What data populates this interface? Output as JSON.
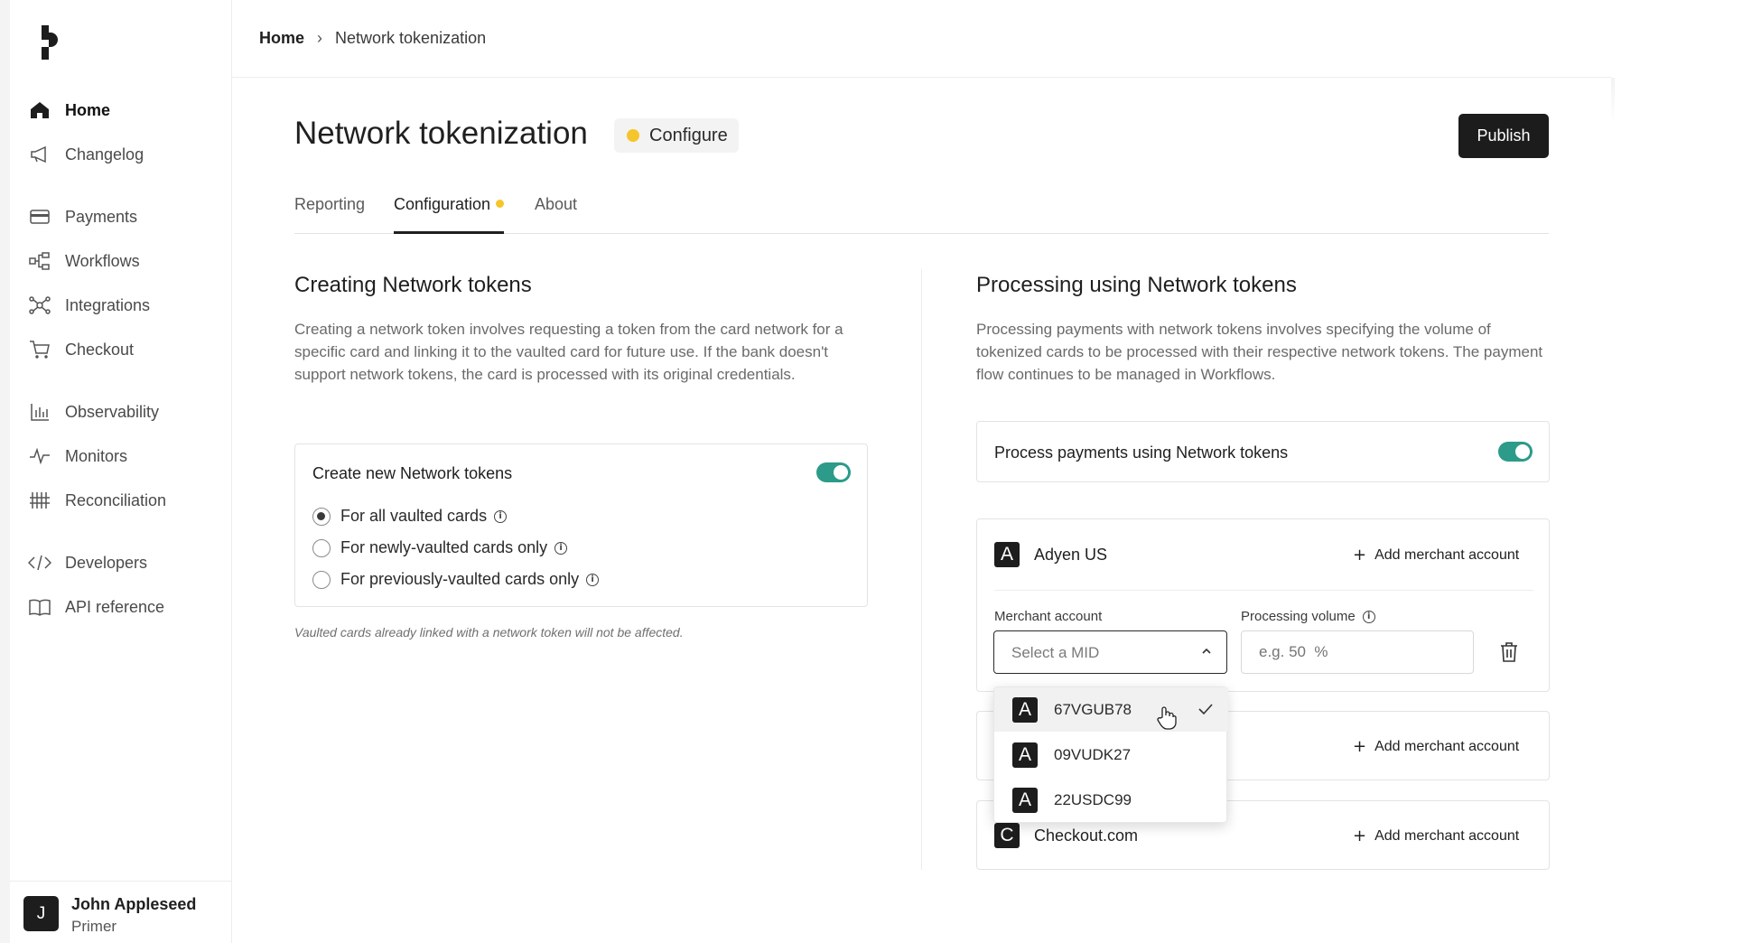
{
  "sidebar": {
    "logo": "primer-logo",
    "items": [
      {
        "label": "Home",
        "icon": "home-icon",
        "active": true
      },
      {
        "label": "Changelog",
        "icon": "megaphone-icon"
      },
      {
        "label": "Payments",
        "icon": "card-icon"
      },
      {
        "label": "Workflows",
        "icon": "workflow-icon"
      },
      {
        "label": "Integrations",
        "icon": "integrations-icon"
      },
      {
        "label": "Checkout",
        "icon": "cart-icon"
      },
      {
        "label": "Observability",
        "icon": "bar-chart-icon"
      },
      {
        "label": "Monitors",
        "icon": "pulse-icon"
      },
      {
        "label": "Reconciliation",
        "icon": "reconciliation-icon"
      },
      {
        "label": "Developers",
        "icon": "code-icon"
      },
      {
        "label": "API reference",
        "icon": "book-icon"
      }
    ],
    "user": {
      "initial": "J",
      "name": "John Appleseed",
      "org": "Primer"
    }
  },
  "breadcrumb": {
    "home": "Home",
    "separator": "›",
    "current": "Network tokenization"
  },
  "header": {
    "title": "Network tokenization",
    "status_badge": "Configure",
    "publish_label": "Publish"
  },
  "tabs": [
    {
      "label": "Reporting"
    },
    {
      "label": "Configuration",
      "active": true,
      "has_dot": true
    },
    {
      "label": "About"
    }
  ],
  "create_section": {
    "title": "Creating Network tokens",
    "description": "Creating a network token involves requesting a token from the card network for a specific card and linking it to the vaulted card for future use. If the bank doesn't support network tokens, the card is processed with its original credentials.",
    "card_title": "Create new Network tokens",
    "toggle_on": true,
    "options": [
      {
        "label": "For all vaulted cards",
        "checked": true
      },
      {
        "label": "For newly-vaulted cards only",
        "checked": false
      },
      {
        "label": "For previously-vaulted cards only",
        "checked": false
      }
    ],
    "note": "Vaulted cards already linked with a network token will not be affected."
  },
  "process_section": {
    "title": "Processing using Network tokens",
    "description": "Processing payments with network tokens involves specifying the volume of tokenized cards to be processed with their respective network tokens. The payment flow continues to be managed in Workflows.",
    "card_title": "Process payments using Network tokens",
    "toggle_on": true,
    "providers": [
      {
        "initial": "A",
        "name": "Adyen US",
        "add_label": "Add merchant account"
      },
      {
        "initial": "",
        "name": "",
        "add_label": "Add merchant account"
      },
      {
        "initial": "C",
        "name": "Checkout.com",
        "add_label": "Add merchant account"
      }
    ],
    "merchant_label": "Merchant account",
    "volume_label": "Processing volume",
    "select_placeholder": "Select a MID",
    "volume_placeholder": "e.g. 50  %",
    "dropdown_options": [
      {
        "initial": "A",
        "label": "67VGUB78",
        "selected": true
      },
      {
        "initial": "A",
        "label": "09VUDK27",
        "selected": false
      },
      {
        "initial": "A",
        "label": "22USDC99",
        "selected": false
      }
    ]
  },
  "colors": {
    "accent_green": "#2c9b89",
    "status_yellow": "#f5c52b",
    "dark": "#1c1c1c"
  }
}
